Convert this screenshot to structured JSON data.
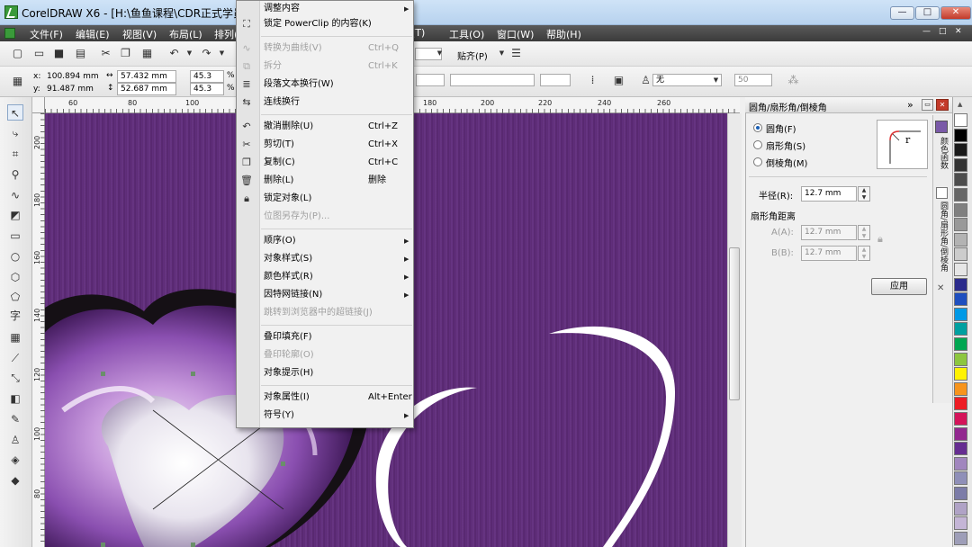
{
  "window": {
    "title": "CorelDRAW X6 - [H:\\鱼鱼课程\\CDR正式学员授课\\",
    "min": "—",
    "max": "□",
    "close": "✕",
    "doc_min": "—",
    "doc_max": "□",
    "doc_close": "✕"
  },
  "menu": {
    "items": [
      "文件(F)",
      "编辑(E)",
      "视图(V)",
      "布局(L)",
      "排列(",
      "(T)",
      "工具(O)",
      "窗口(W)",
      "帮助(H)"
    ]
  },
  "toolbar": {
    "snap_label": "贴齐(P)"
  },
  "props": {
    "x_label": "x:",
    "x_value": "100.894 mm",
    "y_label": "y:",
    "y_value": "91.487 mm",
    "w_value": "57.432 mm",
    "h_value": "52.687 mm",
    "sx_value": "45.3",
    "sy_value": "45.3",
    "pct": "%",
    "outline_value": "无",
    "num_value": "50"
  },
  "rulers": {
    "top": [
      "60",
      "80",
      "100",
      "180",
      "200",
      "220",
      "240",
      "260"
    ],
    "left": [
      "200",
      "180",
      "160",
      "140",
      "120",
      "100",
      "80"
    ]
  },
  "toolbox": {
    "text_tool": "字"
  },
  "context_menu": {
    "items": [
      {
        "label": "调整内容",
        "shortcut": "",
        "disabled": false,
        "submenu": true,
        "icon": ""
      },
      {
        "label": "锁定 PowerClip 的内容(K)",
        "shortcut": "",
        "disabled": false,
        "submenu": false,
        "icon": "lock-powerclip-icon"
      },
      {
        "label": "转换为曲线(V)",
        "shortcut": "Ctrl+Q",
        "disabled": true,
        "submenu": false,
        "icon": "convert-curve-icon"
      },
      {
        "label": "拆分",
        "shortcut": "Ctrl+K",
        "disabled": true,
        "submenu": false,
        "icon": "split-icon"
      },
      {
        "label": "段落文本换行(W)",
        "shortcut": "",
        "disabled": false,
        "submenu": false,
        "icon": "wrap-text-icon"
      },
      {
        "label": "连线换行",
        "shortcut": "",
        "disabled": false,
        "submenu": false,
        "icon": "connector-wrap-icon"
      },
      {
        "label": "撤消删除(U)",
        "shortcut": "Ctrl+Z",
        "disabled": false,
        "submenu": false,
        "icon": "undo-icon"
      },
      {
        "label": "剪切(T)",
        "shortcut": "Ctrl+X",
        "disabled": false,
        "submenu": false,
        "icon": "cut-icon"
      },
      {
        "label": "复制(C)",
        "shortcut": "Ctrl+C",
        "disabled": false,
        "submenu": false,
        "icon": "copy-icon"
      },
      {
        "label": "删除(L)",
        "shortcut": "删除",
        "disabled": false,
        "submenu": false,
        "icon": "delete-icon"
      },
      {
        "label": "锁定对象(L)",
        "shortcut": "",
        "disabled": false,
        "submenu": false,
        "icon": "lock-icon"
      },
      {
        "label": "位图另存为(P)...",
        "shortcut": "",
        "disabled": true,
        "submenu": false,
        "icon": ""
      },
      {
        "label": "顺序(O)",
        "shortcut": "",
        "disabled": false,
        "submenu": true,
        "icon": ""
      },
      {
        "label": "对象样式(S)",
        "shortcut": "",
        "disabled": false,
        "submenu": true,
        "icon": ""
      },
      {
        "label": "颜色样式(R)",
        "shortcut": "",
        "disabled": false,
        "submenu": true,
        "icon": ""
      },
      {
        "label": "因特网链接(N)",
        "shortcut": "",
        "disabled": false,
        "submenu": true,
        "icon": ""
      },
      {
        "label": "跳转到浏览器中的超链接(J)",
        "shortcut": "",
        "disabled": true,
        "submenu": false,
        "icon": ""
      },
      {
        "label": "叠印填充(F)",
        "shortcut": "",
        "disabled": false,
        "submenu": false,
        "icon": ""
      },
      {
        "label": "叠印轮廓(O)",
        "shortcut": "",
        "disabled": true,
        "submenu": false,
        "icon": ""
      },
      {
        "label": "对象提示(H)",
        "shortcut": "",
        "disabled": false,
        "submenu": false,
        "icon": ""
      },
      {
        "label": "对象属性(I)",
        "shortcut": "Alt+Enter",
        "disabled": false,
        "submenu": false,
        "icon": ""
      },
      {
        "label": "符号(Y)",
        "shortcut": "",
        "disabled": false,
        "submenu": true,
        "icon": ""
      }
    ]
  },
  "docker": {
    "title": "圆角/扇形角/倒棱角",
    "options": [
      {
        "label": "圆角(F)",
        "selected": true
      },
      {
        "label": "扇形角(S)",
        "selected": false
      },
      {
        "label": "倒棱角(M)",
        "selected": false
      }
    ],
    "radius_label": "半径(R):",
    "radius_value": "12.7 mm",
    "scallop_title": "扇形角距离",
    "a_label": "A(A):",
    "a_value": "12.7 mm",
    "b_label": "B(B):",
    "b_value": "12.7 mm",
    "apply_label": "应用",
    "preview_letter": "r",
    "tabs": [
      "颜色函数",
      "圆角/扇形角/倒棱角"
    ]
  },
  "palette": {
    "colors": [
      "#ffffff",
      "#000000",
      "#1a1a1a",
      "#333333",
      "#4d4d4d",
      "#666666",
      "#808080",
      "#999999",
      "#b3b3b3",
      "#cccccc",
      "#e6e6e6",
      "#2b2b8c",
      "#1f4fbf",
      "#0099e6",
      "#00a0a0",
      "#00a651",
      "#8dc63f",
      "#fff200",
      "#f7941d",
      "#ed1c24",
      "#d4145a",
      "#92278f",
      "#662d91",
      "#a186be",
      "#8f8fb8",
      "#7c7ca8",
      "#b0a3c6",
      "#c4b5d6",
      "#9e9eb8"
    ]
  }
}
